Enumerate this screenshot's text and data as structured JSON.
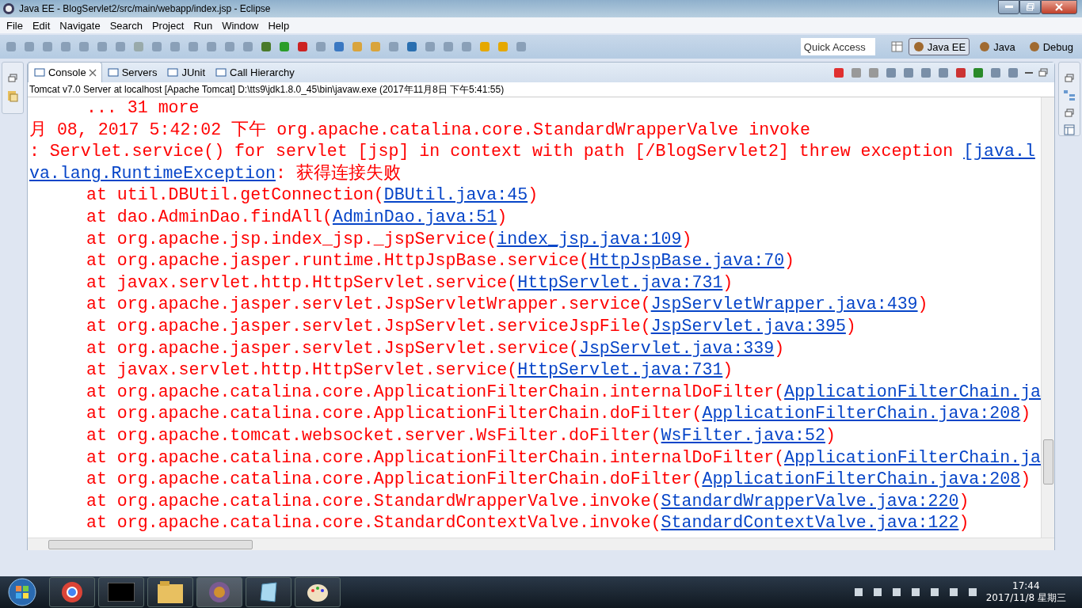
{
  "window": {
    "title": "Java EE - BlogServlet2/src/main/webapp/index.jsp - Eclipse"
  },
  "menu": [
    "File",
    "Edit",
    "Navigate",
    "Search",
    "Project",
    "Run",
    "Window",
    "Help"
  ],
  "quick_access": {
    "placeholder": "Quick Access"
  },
  "perspectives": [
    {
      "label": "Java EE",
      "selected": true
    },
    {
      "label": "Java",
      "selected": false
    },
    {
      "label": "Debug",
      "selected": false
    }
  ],
  "tabs": [
    {
      "label": "Console",
      "selected": true
    },
    {
      "label": "Servers",
      "selected": false
    },
    {
      "label": "JUnit",
      "selected": false
    },
    {
      "label": "Call Hierarchy",
      "selected": false
    }
  ],
  "console": {
    "description": "Tomcat v7.0 Server at localhost [Apache Tomcat] D:\\tts9\\jdk1.8.0_45\\bin\\javaw.exe (2017年11月8日 下午5:41:55)",
    "lines": [
      {
        "kind": "indented",
        "segments": [
          {
            "text": "... 31 more",
            "link": false
          }
        ]
      },
      {
        "kind": "plain",
        "segments": [
          {
            "text": "月 08, 2017 5:42:02 下午 org.apache.catalina.core.StandardWrapperValve invoke",
            "link": false
          }
        ]
      },
      {
        "kind": "plain",
        "segments": [
          {
            "text": ": Servlet.service() for servlet [jsp] in context with path [/BlogServlet2] threw exception ",
            "link": false
          },
          {
            "text": "[java.l",
            "link": true
          }
        ]
      },
      {
        "kind": "plain",
        "segments": [
          {
            "text": "va.lang.RuntimeException",
            "link": true
          },
          {
            "text": ": 获得连接失败",
            "link": false
          }
        ]
      },
      {
        "kind": "indented",
        "segments": [
          {
            "text": "at util.DBUtil.getConnection(",
            "link": false
          },
          {
            "text": "DBUtil.java:45",
            "link": true
          },
          {
            "text": ")",
            "link": false
          }
        ]
      },
      {
        "kind": "indented",
        "segments": [
          {
            "text": "at dao.AdminDao.findAll(",
            "link": false
          },
          {
            "text": "AdminDao.java:51",
            "link": true
          },
          {
            "text": ")",
            "link": false
          }
        ]
      },
      {
        "kind": "indented",
        "segments": [
          {
            "text": "at org.apache.jsp.index_jsp._jspService(",
            "link": false
          },
          {
            "text": "index_jsp.java:109",
            "link": true
          },
          {
            "text": ")",
            "link": false
          }
        ]
      },
      {
        "kind": "indented",
        "segments": [
          {
            "text": "at org.apache.jasper.runtime.HttpJspBase.service(",
            "link": false
          },
          {
            "text": "HttpJspBase.java:70",
            "link": true
          },
          {
            "text": ")",
            "link": false
          }
        ]
      },
      {
        "kind": "indented",
        "segments": [
          {
            "text": "at javax.servlet.http.HttpServlet.service(",
            "link": false
          },
          {
            "text": "HttpServlet.java:731",
            "link": true
          },
          {
            "text": ")",
            "link": false
          }
        ]
      },
      {
        "kind": "indented",
        "segments": [
          {
            "text": "at org.apache.jasper.servlet.JspServletWrapper.service(",
            "link": false
          },
          {
            "text": "JspServletWrapper.java:439",
            "link": true
          },
          {
            "text": ")",
            "link": false
          }
        ]
      },
      {
        "kind": "indented",
        "segments": [
          {
            "text": "at org.apache.jasper.servlet.JspServlet.serviceJspFile(",
            "link": false
          },
          {
            "text": "JspServlet.java:395",
            "link": true
          },
          {
            "text": ")",
            "link": false
          }
        ]
      },
      {
        "kind": "indented",
        "segments": [
          {
            "text": "at org.apache.jasper.servlet.JspServlet.service(",
            "link": false
          },
          {
            "text": "JspServlet.java:339",
            "link": true
          },
          {
            "text": ")",
            "link": false
          }
        ]
      },
      {
        "kind": "indented",
        "segments": [
          {
            "text": "at javax.servlet.http.HttpServlet.service(",
            "link": false
          },
          {
            "text": "HttpServlet.java:731",
            "link": true
          },
          {
            "text": ")",
            "link": false
          }
        ]
      },
      {
        "kind": "indented",
        "segments": [
          {
            "text": "at org.apache.catalina.core.ApplicationFilterChain.internalDoFilter(",
            "link": false
          },
          {
            "text": "ApplicationFilterChain.ja",
            "link": true
          }
        ]
      },
      {
        "kind": "indented",
        "segments": [
          {
            "text": "at org.apache.catalina.core.ApplicationFilterChain.doFilter(",
            "link": false
          },
          {
            "text": "ApplicationFilterChain.java:208",
            "link": true
          },
          {
            "text": ")",
            "link": false
          }
        ]
      },
      {
        "kind": "indented",
        "segments": [
          {
            "text": "at org.apache.tomcat.websocket.server.WsFilter.doFilter(",
            "link": false
          },
          {
            "text": "WsFilter.java:52",
            "link": true
          },
          {
            "text": ")",
            "link": false
          }
        ]
      },
      {
        "kind": "indented",
        "segments": [
          {
            "text": "at org.apache.catalina.core.ApplicationFilterChain.internalDoFilter(",
            "link": false
          },
          {
            "text": "ApplicationFilterChain.ja",
            "link": true
          }
        ]
      },
      {
        "kind": "indented",
        "segments": [
          {
            "text": "at org.apache.catalina.core.ApplicationFilterChain.doFilter(",
            "link": false
          },
          {
            "text": "ApplicationFilterChain.java:208",
            "link": true
          },
          {
            "text": ")",
            "link": false
          }
        ]
      },
      {
        "kind": "indented",
        "segments": [
          {
            "text": "at org.apache.catalina.core.StandardWrapperValve.invoke(",
            "link": false
          },
          {
            "text": "StandardWrapperValve.java:220",
            "link": true
          },
          {
            "text": ")",
            "link": false
          }
        ]
      },
      {
        "kind": "indented",
        "segments": [
          {
            "text": "at org.apache.catalina.core.StandardContextValve.invoke(",
            "link": false
          },
          {
            "text": "StandardContextValve.java:122",
            "link": true
          },
          {
            "text": ")",
            "link": false
          }
        ]
      }
    ]
  },
  "taskbar": {
    "time": "17:44",
    "date": "2017/11/8 星期三"
  }
}
